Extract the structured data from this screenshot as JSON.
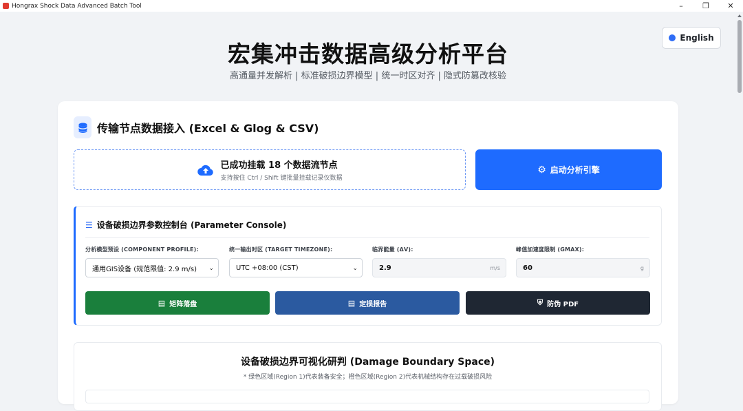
{
  "window": {
    "title": "Hongrax Shock Data Advanced Batch Tool",
    "controls": [
      "minimize",
      "restore",
      "close"
    ]
  },
  "header": {
    "language_button": "English",
    "title": "宏集冲击数据高级分析平台",
    "subtitle": "高通量并发解析 | 标准破损边界模型 | 统一时区对齐 | 隐式防篡改核验"
  },
  "ingest": {
    "section_title": "传输节点数据接入 (Excel & Glog & CSV)",
    "upload_status": "已成功挂载 18 个数据流节点",
    "upload_hint": "支持按住 Ctrl / Shift 键批量挂载记录仪数据",
    "start_button": "启动分析引擎"
  },
  "console": {
    "title": "设备破损边界参数控制台 (Parameter Console)",
    "profile_label": "分析模型预设 (COMPONENT PROFILE):",
    "profile_value": "通用GIS设备 (规范限值: 2.9 m/s)",
    "timezone_label": "统一输出时区 (TARGET TIMEZONE):",
    "timezone_value": "UTC +08:00 (CST)",
    "dv_label": "临界能量 (ΔV):",
    "dv_value": "2.9",
    "dv_unit": "m/s",
    "gmax_label": "峰值加速度限制 (GMAX):",
    "gmax_value": "60",
    "gmax_unit": "g",
    "buttons": {
      "matrix": "矩阵落盘",
      "report": "定损报告",
      "pdf": "防伪 PDF"
    },
    "colors": {
      "matrix": "#1a7f3c",
      "report": "#2b5aa0",
      "pdf": "#1f2733"
    }
  },
  "visualization": {
    "title": "设备破损边界可视化研判 (Damage Boundary Space)",
    "subtitle": "* 绿色区域(Region 1)代表装备安全；橙色区域(Region 2)代表机械结构存在过载破损风险"
  },
  "colors": {
    "accent": "#1e6bff",
    "page_bg": "#f1f3f6"
  }
}
